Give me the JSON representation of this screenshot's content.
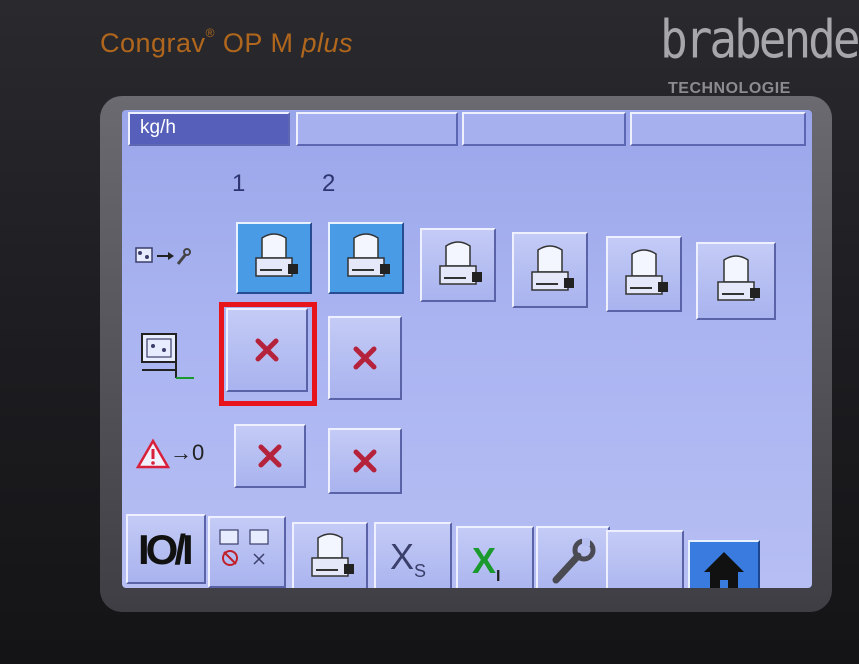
{
  "brand": {
    "product_name": "Congrav",
    "product_mark": "®",
    "product_model": "OP M",
    "product_suffix": "plus",
    "logo": "brabender",
    "logo_sub": "TECHNOLOGIE"
  },
  "tabs": [
    {
      "label": "kg/h",
      "active": true
    },
    {
      "label": "",
      "active": false
    },
    {
      "label": "",
      "active": false
    },
    {
      "label": "",
      "active": false
    }
  ],
  "columns": [
    "1",
    "2"
  ],
  "rows": {
    "feeder": {
      "icon": "feeder-to-wrench-icon",
      "items": 6,
      "selected": [
        1,
        2
      ]
    },
    "refill": {
      "icon": "refill-valve-icon",
      "values": [
        "✕",
        "✕"
      ]
    },
    "alarm": {
      "icon": "alarm-reset-icon",
      "label": "→0",
      "values": [
        "✕",
        "✕"
      ]
    }
  },
  "toolbar": {
    "onoff_label": "IO/I",
    "xs_label": "X",
    "xs_sub": "S",
    "xi_label": "X",
    "xi_sub": "I"
  },
  "colors": {
    "screen": "#a7b0ee",
    "active_tab": "#5660bb",
    "selected_button": "#4a9be6",
    "x_mark": "#b5223b",
    "highlight": "#e8141c",
    "brand_orange": "#b0661c"
  }
}
